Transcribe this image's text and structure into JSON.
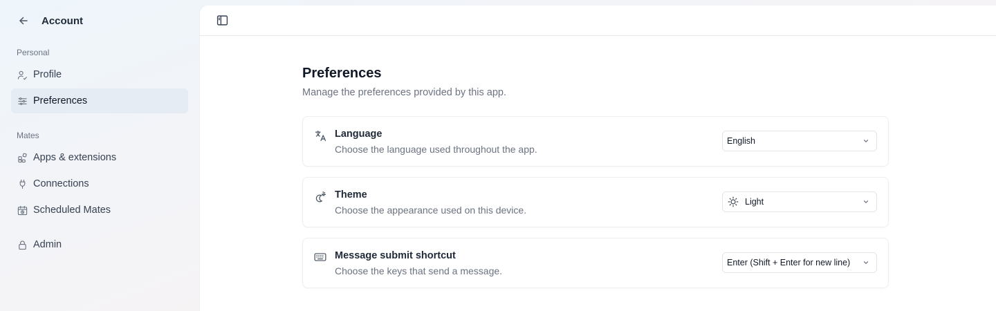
{
  "sidebar": {
    "title": "Account",
    "sections": {
      "personal": "Personal",
      "mates": "Mates"
    },
    "items": {
      "profile": "Profile",
      "preferences": "Preferences",
      "apps": "Apps & extensions",
      "connections": "Connections",
      "scheduled": "Scheduled Mates",
      "admin": "Admin"
    },
    "active_item": "preferences"
  },
  "main": {
    "title": "Preferences",
    "subtitle": "Manage the preferences provided by this app.",
    "cards": {
      "language": {
        "title": "Language",
        "description": "Choose the language used throughout the app.",
        "value": "English",
        "icon": "language-icon"
      },
      "theme": {
        "title": "Theme",
        "description": "Choose the appearance used on this device.",
        "value": "Light",
        "icon": "theme-icon",
        "value_icon": "sun-icon"
      },
      "shortcut": {
        "title": "Message submit shortcut",
        "description": "Choose the keys that send a message.",
        "value": "Enter (Shift + Enter for new line)",
        "icon": "keyboard-icon"
      }
    }
  },
  "colors": {
    "text_primary": "#111827",
    "text_secondary": "#6b7280",
    "active_bg": "#e2e8f0",
    "border": "#eceef1"
  }
}
